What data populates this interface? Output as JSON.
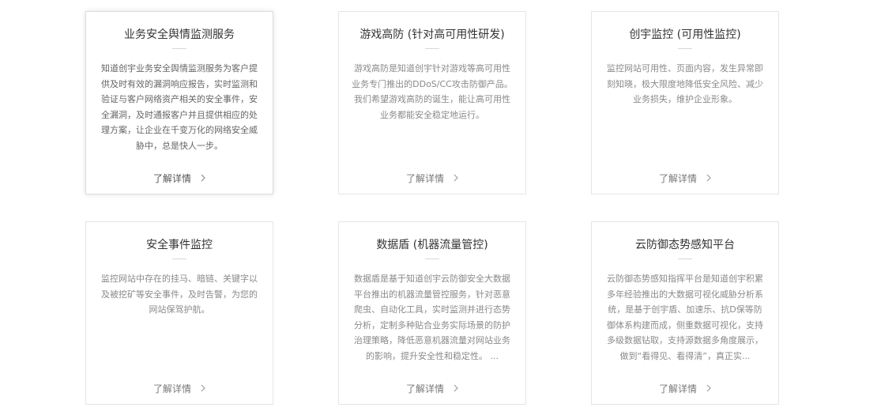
{
  "cards": [
    {
      "title": "业务安全舆情监测服务",
      "description": "知道创宇业务安全舆情监测服务为客户提供及时有效的漏洞响应报告，实时监测和验证与客户网络资产相关的安全事件，安全漏洞，及时通报客户并且提供相应的处理方案，让企业在千变万化的网络安全威胁中，总是快人一步。",
      "link": "了解详情"
    },
    {
      "title": "游戏高防 (针对高可用性研发)",
      "description": "游戏高防是知道创宇针对游戏等高可用性业务专门推出的DDoS/CC攻击防御产品。我们希望游戏高防的诞生，能让高可用性业务都能安全稳定地运行。",
      "link": "了解详情"
    },
    {
      "title": "创宇监控 (可用性监控)",
      "description": "监控网站可用性、页面内容，发生异常即刻知晓，极大限度地降低安全风险、减少业务损失，维护企业形象。",
      "link": "了解详情"
    },
    {
      "title": "安全事件监控",
      "description": "监控网站中存在的挂马、暗链、关键字以及被挖矿等安全事件，及时告警，为您的网站保驾护航。",
      "link": "了解详情"
    },
    {
      "title": "数据盾 (机器流量管控)",
      "description": "数据盾是基于知道创宇云防御安全大数据平台推出的机器流量管控服务，针对恶意爬虫、自动化工具，实时监测并进行态势分析，定制多种贴合业务实际场景的防护治理策略，降低恶意机器流量对网站业务的影响，提升安全性和稳定性。 ...",
      "link": "了解详情"
    },
    {
      "title": "云防御态势感知平台",
      "description": "云防御态势感知指挥平台是知道创宇积累多年经验推出的大数据可视化威胁分析系统，是基于创宇盾、加速乐、抗D保等防御体系构建而成，侧重数据可视化，支持多级数据钻取，支持源数据多角度展示，做到“看得见、看得清”，真正实...",
      "link": "了解详情"
    }
  ]
}
